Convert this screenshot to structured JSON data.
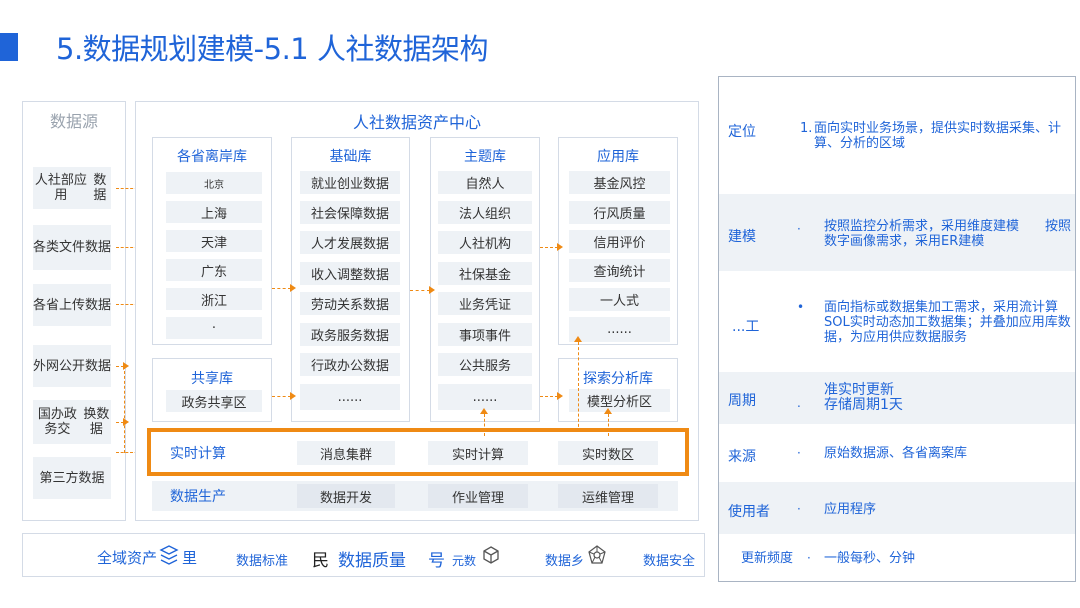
{
  "title": "5.数据规划建模-5.1 人社数据架构",
  "sources": {
    "title": "数据源",
    "items": [
      {
        "line1": "人社部应用",
        "line2": "数据"
      },
      {
        "line1": "各类文件",
        "line2": "数据"
      },
      {
        "line1": "各省上传",
        "line2": "数据"
      },
      {
        "line1": "外网公开",
        "line2": "数据"
      },
      {
        "line1": "国办政务交",
        "line2": "换数据"
      },
      {
        "line1": "第三方数据",
        "line2": ""
      }
    ]
  },
  "center": {
    "title": "人社数据资产中心",
    "offshore": {
      "title": "各省离岸库",
      "items": [
        "北京",
        "上海",
        "天津",
        "广东",
        "浙江",
        "·"
      ]
    },
    "base": {
      "title": "基础库",
      "items": [
        "就业创业数据",
        "社会保障数据",
        "人才发展数据",
        "收入调整数据",
        "劳动关系数据",
        "政务服务数据",
        "行政办公数据",
        "......"
      ]
    },
    "topic": {
      "title": "主题库",
      "items": [
        "自然人",
        "法人组织",
        "人社机构",
        "社保基金",
        "业务凭证",
        "事项事件",
        "公共服务",
        "......"
      ]
    },
    "app": {
      "title": "应用库",
      "items": [
        "基金风控",
        "行风质量",
        "信用评价",
        "查询统计",
        "一人式",
        "......"
      ]
    },
    "shared": {
      "title": "共享库",
      "item": "政务共享区"
    },
    "explore": {
      "title": "探索分析库",
      "item": "模型分析区"
    },
    "realtime": {
      "label": "实时计算",
      "items": [
        "消息集群",
        "实时计算",
        "实时数区"
      ]
    },
    "production": {
      "label": "数据生产",
      "items": [
        "数据开发",
        "作业管理",
        "运维管理"
      ]
    }
  },
  "bottom": {
    "asset": "全域资产",
    "asset_icon": "stack-icon",
    "asset_tail": "里",
    "standard": "数据标准",
    "min_char": "民",
    "quality": "数据质量",
    "hao_char": "号",
    "meta": "元数",
    "meta_icon": "cube-icon",
    "lineage": "数据乡",
    "lineage_icon": "network-icon",
    "security": "数据安全"
  },
  "right": {
    "rows": [
      {
        "label": "定位",
        "bullet": "1.",
        "text": "面向实时业务场景，提供实时数据采集、计算、分析的区域"
      },
      {
        "label": "建模",
        "bullet": "·",
        "text": "按照监控分析需求，采用维度建模　　按照数字画像需求，采用ER建模"
      },
      {
        "label": "...工",
        "bullet": "•",
        "text": "面向指标或数据集加工需求，采用流计算SOL实时动态加工数据集；并叠加应用库数据，为应用供应数据服务"
      },
      {
        "label": "周期",
        "bullet": ".",
        "text": "准实时更新\n存储周期1天"
      },
      {
        "label": "来源",
        "bullet": "·",
        "text": "原始数据源、各省离案库"
      },
      {
        "label": "使用者",
        "bullet": "·",
        "text": "应用程序"
      },
      {
        "label": "更新频度",
        "bullet": "·",
        "text": "一般每秒、分钟"
      }
    ]
  },
  "colors": {
    "accent": "#1f64d8",
    "highlight": "#ef8a14",
    "cell": "#eef2f6",
    "border": "#d4dbe6"
  }
}
